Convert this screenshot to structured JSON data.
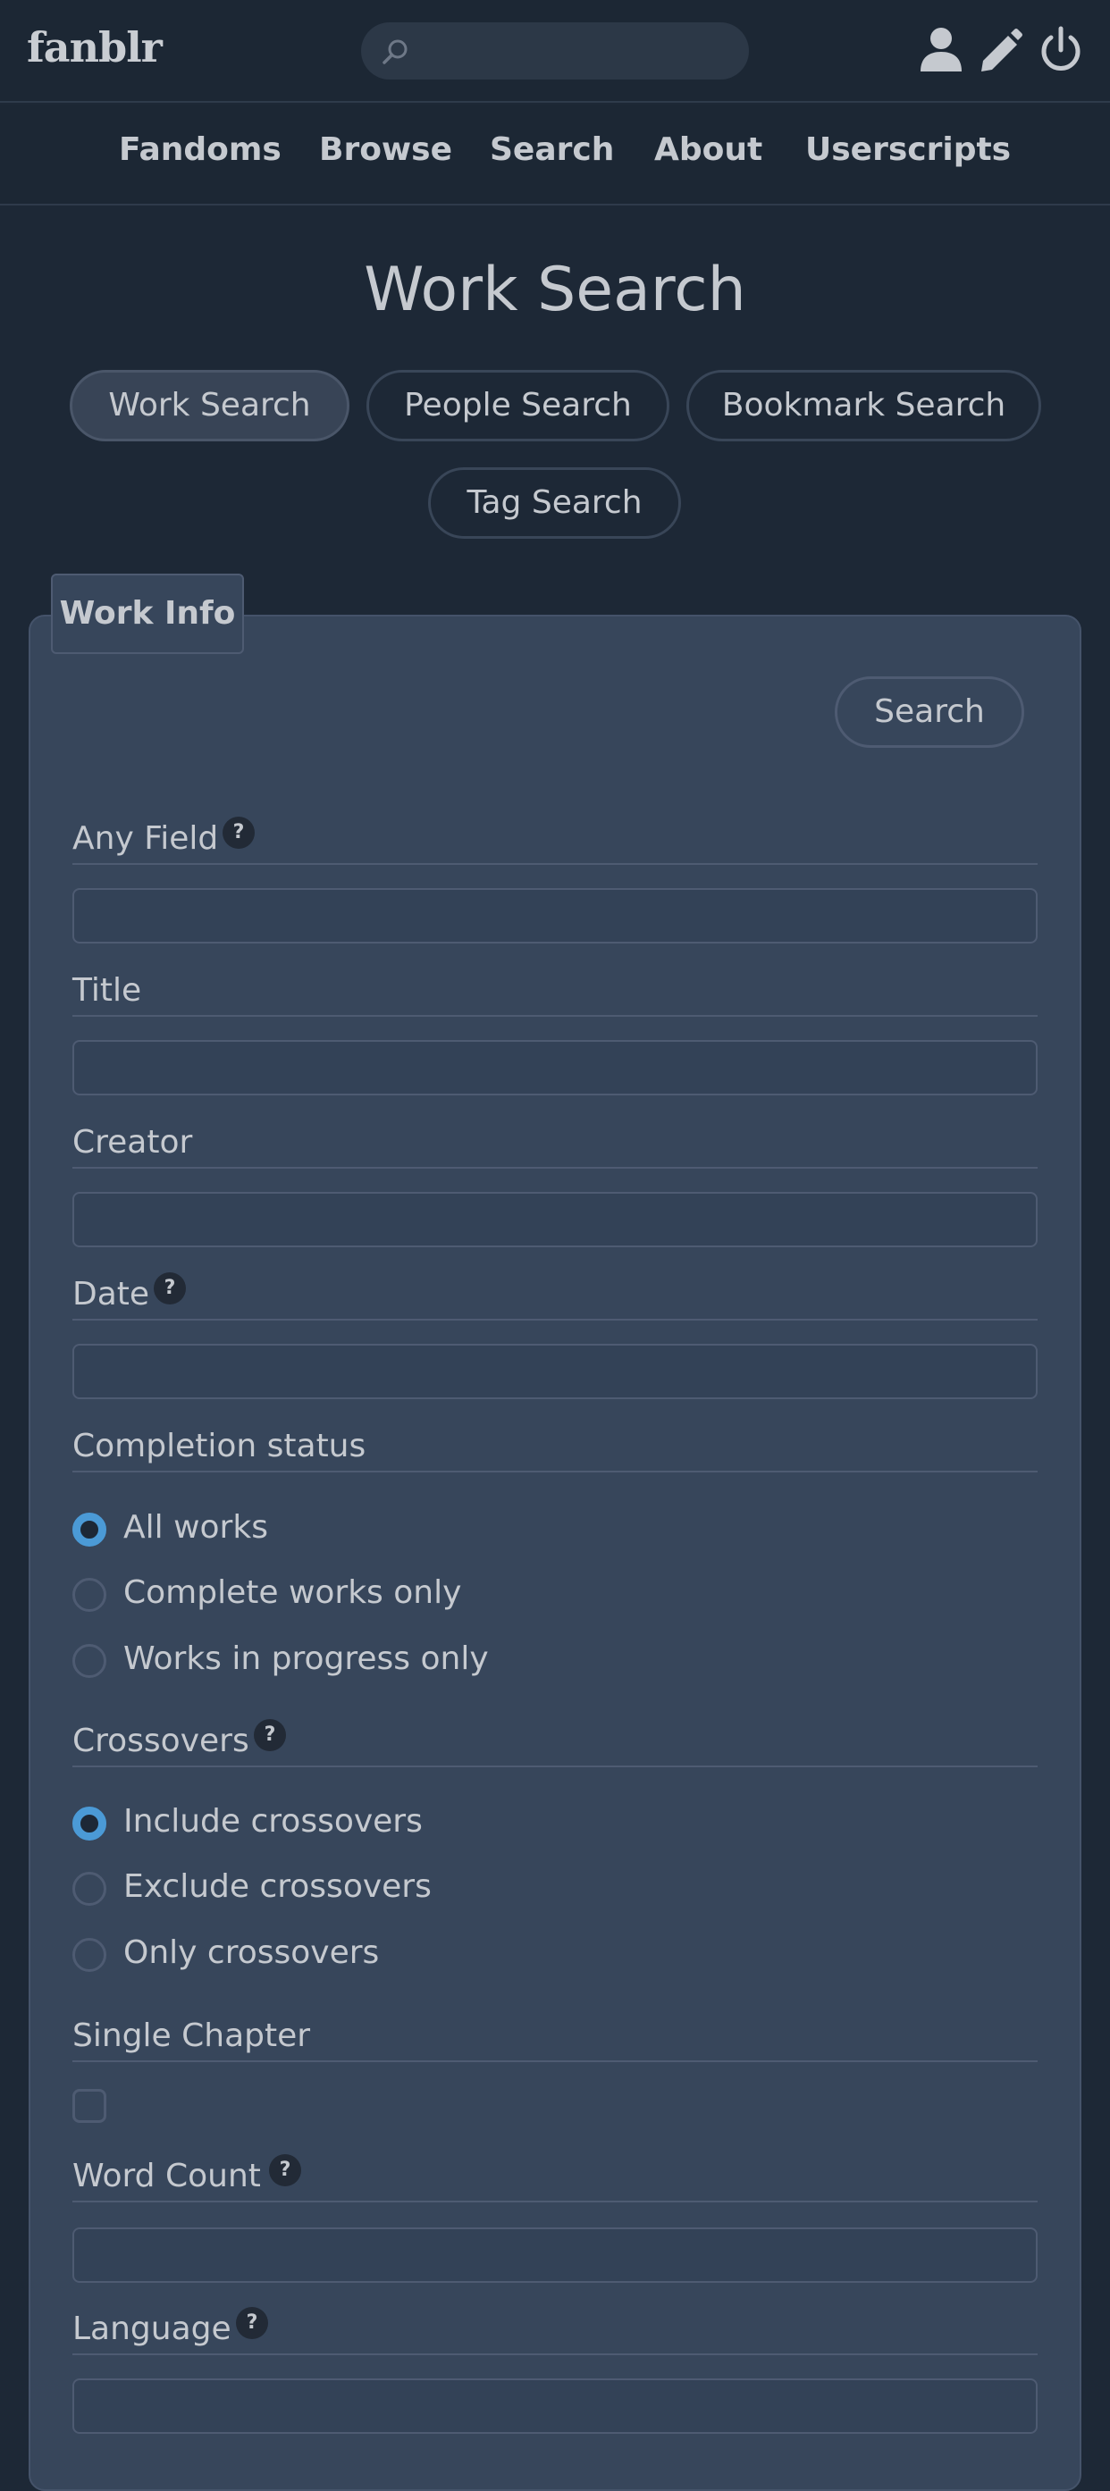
{
  "header": {
    "logo": "fanblr",
    "search_placeholder": ""
  },
  "nav": {
    "items": [
      "Fandoms",
      "Browse",
      "Search",
      "About",
      "Userscripts"
    ]
  },
  "page": {
    "title": "Work Search"
  },
  "search_types": [
    {
      "label": "Work Search",
      "active": true
    },
    {
      "label": "People Search",
      "active": false
    },
    {
      "label": "Bookmark Search",
      "active": false
    },
    {
      "label": "Tag Search",
      "active": false
    }
  ],
  "form": {
    "tab_label": "Work Info",
    "search_button": "Search",
    "fields": {
      "any_field": {
        "label": "Any Field",
        "help": "?",
        "value": ""
      },
      "title": {
        "label": "Title",
        "value": ""
      },
      "creator": {
        "label": "Creator",
        "value": ""
      },
      "date": {
        "label": "Date",
        "help": "?",
        "value": ""
      },
      "completion_status": {
        "label": "Completion status",
        "options": [
          "All works",
          "Complete works only",
          "Works in progress only"
        ],
        "selected": "All works"
      },
      "crossovers": {
        "label": "Crossovers",
        "help": "?",
        "options": [
          "Include crossovers",
          "Exclude crossovers",
          "Only crossovers"
        ],
        "selected": "Include crossovers"
      },
      "single_chapter": {
        "label": "Single Chapter",
        "checked": false
      },
      "word_count": {
        "label": "Word Count",
        "help": "?",
        "value": ""
      },
      "language": {
        "label": "Language",
        "help": "?",
        "value": ""
      }
    }
  },
  "colors": {
    "background": "#1d2836",
    "panel": "#37465b",
    "accent": "#4b9ad6",
    "text": "#c5c9cf"
  },
  "icons": {
    "search": "search-icon",
    "user": "user-icon",
    "pencil": "pencil-icon",
    "power": "power-icon"
  }
}
